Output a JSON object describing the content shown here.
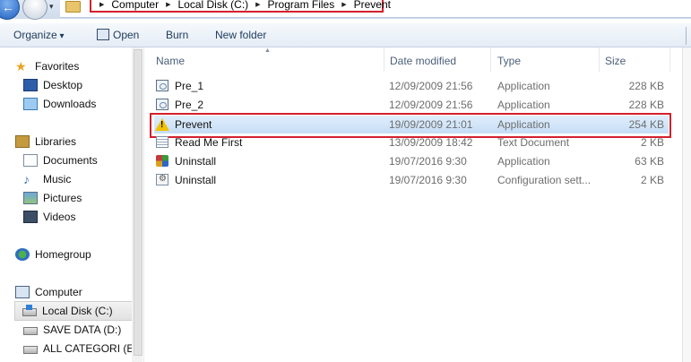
{
  "address": {
    "breadcrumbs": [
      "Computer",
      "Local Disk (C:)",
      "Program Files",
      "Prevent"
    ]
  },
  "toolbar": {
    "organize": "Organize",
    "open": "Open",
    "burn": "Burn",
    "new_folder": "New folder"
  },
  "sidebar": {
    "favorites": "Favorites",
    "desktop": "Desktop",
    "downloads": "Downloads",
    "libraries": "Libraries",
    "documents": "Documents",
    "music": "Music",
    "pictures": "Pictures",
    "videos": "Videos",
    "homegroup": "Homegroup",
    "computer": "Computer",
    "local_disk": "Local Disk (C:)",
    "save_data": "SAVE DATA (D:)",
    "all_categori": "ALL CATEGORI (E:)"
  },
  "columns": {
    "name": "Name",
    "date": "Date modified",
    "type": "Type",
    "size": "Size"
  },
  "files": [
    {
      "name": "Pre_1",
      "date": "12/09/2009 21:56",
      "type": "Application",
      "size": "228 KB",
      "icon": "application-icon"
    },
    {
      "name": "Pre_2",
      "date": "12/09/2009 21:56",
      "type": "Application",
      "size": "228 KB",
      "icon": "application-icon"
    },
    {
      "name": "Prevent",
      "date": "19/09/2009 21:01",
      "type": "Application",
      "size": "254 KB",
      "icon": "warning-icon",
      "selected": true
    },
    {
      "name": "Read Me First",
      "date": "13/09/2009 18:42",
      "type": "Text Document",
      "size": "2 KB",
      "icon": "text-document-icon"
    },
    {
      "name": "Uninstall",
      "date": "19/07/2016 9:30",
      "type": "Application",
      "size": "63 KB",
      "icon": "uninstall-icon"
    },
    {
      "name": "Uninstall",
      "date": "19/07/2016 9:30",
      "type": "Configuration sett...",
      "size": "2 KB",
      "icon": "settings-file-icon"
    }
  ],
  "colors": {
    "highlight_outline": "#d4202c",
    "selection": "#cce2f8"
  }
}
